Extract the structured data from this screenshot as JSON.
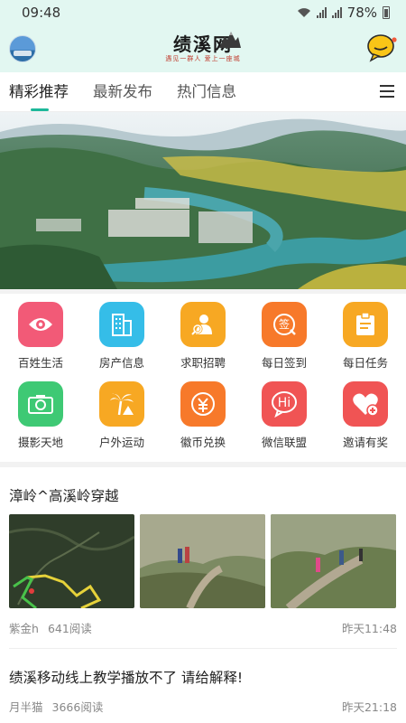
{
  "status_bar": {
    "time": "09:48",
    "battery": "78%"
  },
  "header": {
    "logo_name": "绩溪网",
    "slogan": "遇见一群人 爱上一座城"
  },
  "tabs": [
    {
      "label": "精彩推荐",
      "active": true
    },
    {
      "label": "最新发布",
      "active": false
    },
    {
      "label": "热门信息",
      "active": false
    }
  ],
  "grid": [
    {
      "label": "百姓生活",
      "icon": "eye-icon",
      "color": "#f25a77"
    },
    {
      "label": "房产信息",
      "icon": "building-icon",
      "color": "#35bde8"
    },
    {
      "label": "求职招聘",
      "icon": "job-search-icon",
      "color": "#f7a823"
    },
    {
      "label": "每日签到",
      "icon": "checkin-icon",
      "color": "#f7792a"
    },
    {
      "label": "每日任务",
      "icon": "clipboard-icon",
      "color": "#f7a823"
    },
    {
      "label": "摄影天地",
      "icon": "camera-icon",
      "color": "#3ec974"
    },
    {
      "label": "户外运动",
      "icon": "palm-tree-icon",
      "color": "#f7a823"
    },
    {
      "label": "徽币兑换",
      "icon": "coin-exchange-icon",
      "color": "#f7792a"
    },
    {
      "label": "微信联盟",
      "icon": "chat-hi-icon",
      "color": "#f05454"
    },
    {
      "label": "邀请有奖",
      "icon": "heart-plus-icon",
      "color": "#f05454"
    }
  ],
  "grid_hi_text": "Hi",
  "grid_checkin_text": "签",
  "articles": [
    {
      "title": "漳岭^高溪岭穿越",
      "author": "紫金h",
      "reads": "641阅读",
      "time": "昨天11:48"
    },
    {
      "title": "绩溪移动线上教学播放不了 请给解释!",
      "author": "月半猫",
      "reads": "3666阅读",
      "time": "昨天21:18"
    }
  ]
}
